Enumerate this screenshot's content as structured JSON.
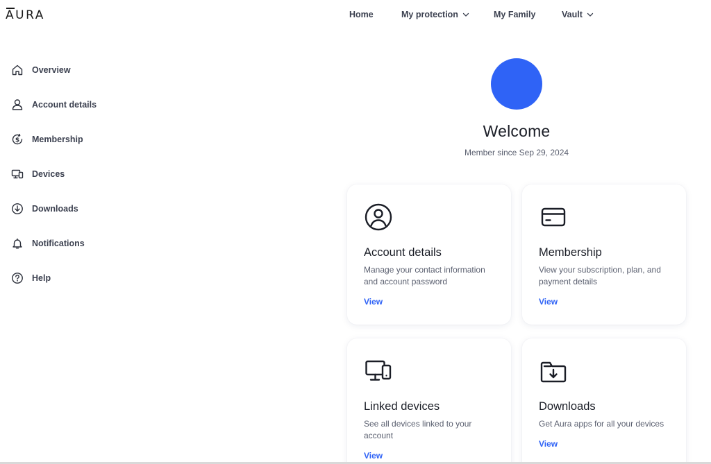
{
  "brand": {
    "logo_text_a": "A",
    "logo_text_rest": "URA"
  },
  "topnav": {
    "home": "Home",
    "protection": "My protection",
    "family": "My Family",
    "vault": "Vault"
  },
  "sidebar": {
    "items": [
      {
        "label": "Overview",
        "icon": "home-icon"
      },
      {
        "label": "Account details",
        "icon": "person-icon"
      },
      {
        "label": "Membership",
        "icon": "dollar-refresh-icon"
      },
      {
        "label": "Devices",
        "icon": "devices-icon"
      },
      {
        "label": "Downloads",
        "icon": "download-icon"
      },
      {
        "label": "Notifications",
        "icon": "bell-icon"
      },
      {
        "label": "Help",
        "icon": "help-icon"
      }
    ]
  },
  "main": {
    "welcome": "Welcome",
    "member_since": "Member since Sep 29, 2024",
    "avatar_color": "#2f63f6",
    "cards": [
      {
        "title": "Account details",
        "desc": "Manage your contact information and account password",
        "link": "View",
        "icon": "account-circle-icon"
      },
      {
        "title": "Membership",
        "desc": "View your subscription, plan, and payment details",
        "link": "View",
        "icon": "credit-card-icon"
      },
      {
        "title": "Linked devices",
        "desc": "See all devices linked to your account",
        "link": "View",
        "icon": "devices-icon"
      },
      {
        "title": "Downloads",
        "desc": "Get Aura apps for all your devices",
        "link": "View",
        "icon": "folder-download-icon"
      }
    ]
  },
  "colors": {
    "accent": "#2f63f6",
    "text": "#1f2430",
    "muted": "#5b6070"
  }
}
